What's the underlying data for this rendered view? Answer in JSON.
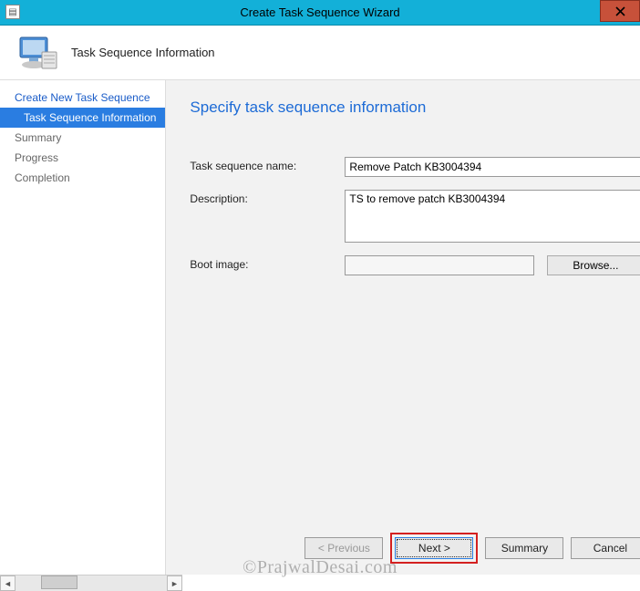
{
  "window": {
    "title": "Create Task Sequence Wizard"
  },
  "header": {
    "title": "Task Sequence Information"
  },
  "sidebar": {
    "items": [
      {
        "label": "Create New Task Sequence",
        "sel": false,
        "inactive": false
      },
      {
        "label": "Task Sequence Information",
        "sel": true,
        "inactive": false
      },
      {
        "label": "Summary",
        "sel": false,
        "inactive": true
      },
      {
        "label": "Progress",
        "sel": false,
        "inactive": true
      },
      {
        "label": "Completion",
        "sel": false,
        "inactive": true
      }
    ]
  },
  "main": {
    "heading": "Specify task sequence information",
    "labels": {
      "name": "Task sequence name:",
      "desc": "Description:",
      "boot": "Boot image:"
    },
    "values": {
      "name": "Remove Patch KB3004394",
      "desc": "TS to remove patch KB3004394",
      "boot": ""
    },
    "browse": "Browse..."
  },
  "buttons": {
    "previous": "< Previous",
    "next": "Next >",
    "summary": "Summary",
    "cancel": "Cancel"
  },
  "watermark": "©PrajwalDesai.com"
}
